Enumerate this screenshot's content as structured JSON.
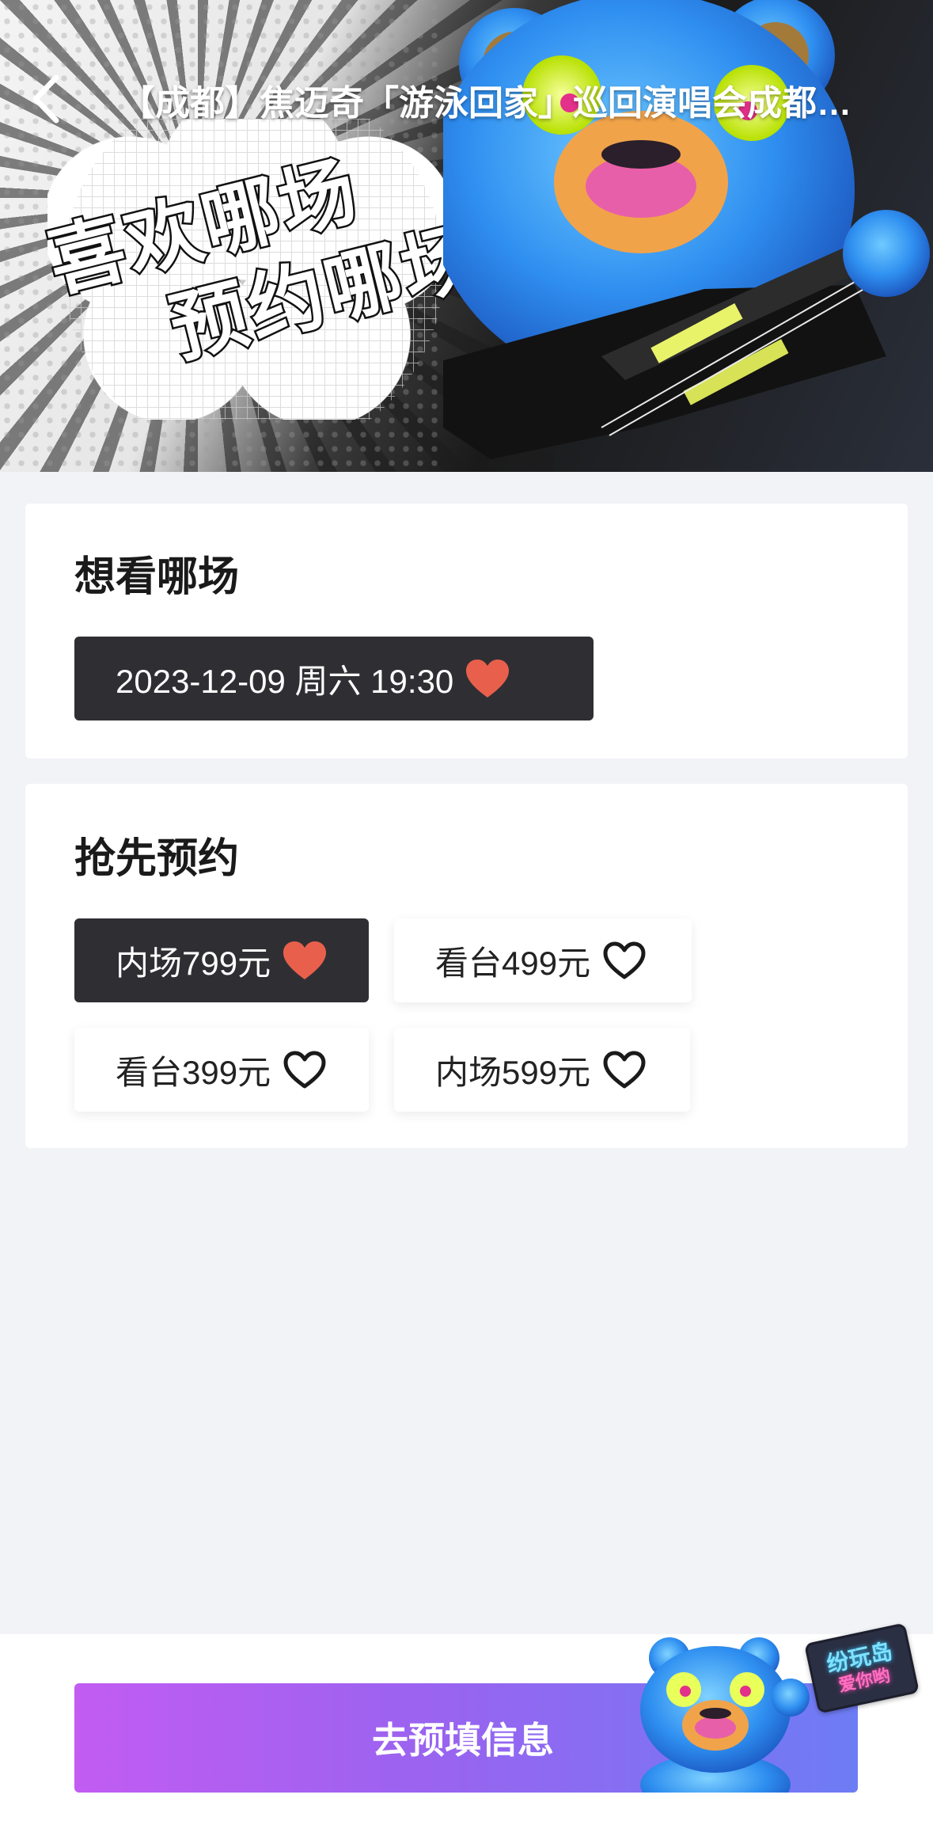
{
  "header": {
    "back_icon": "chevron-left-icon",
    "title": "【成都】焦迈奇「游泳回家」巡回演唱会成都站…"
  },
  "banner": {
    "slogan_line1": "喜欢哪场",
    "slogan_line2": "预约哪场"
  },
  "session_section": {
    "title": "想看哪场",
    "options": [
      {
        "label": "2023-12-09 周六 19:30",
        "selected": true
      }
    ]
  },
  "ticket_section": {
    "title": "抢先预约",
    "options": [
      {
        "label": "内场799元",
        "selected": true
      },
      {
        "label": "看台499元",
        "selected": false
      },
      {
        "label": "看台399元",
        "selected": false
      },
      {
        "label": "内场599元",
        "selected": false
      }
    ]
  },
  "footer": {
    "cta_label": "去预填信息",
    "mascot_sign_line1": "纷玩岛",
    "mascot_sign_line2": "爱你哟"
  },
  "colors": {
    "selected_chip_bg": "#2f2f33",
    "heart_filled": "#e8604c",
    "cta_gradient_start": "#c25cf2",
    "cta_gradient_end": "#6d7cf4",
    "page_bg": "#f2f3f7"
  }
}
